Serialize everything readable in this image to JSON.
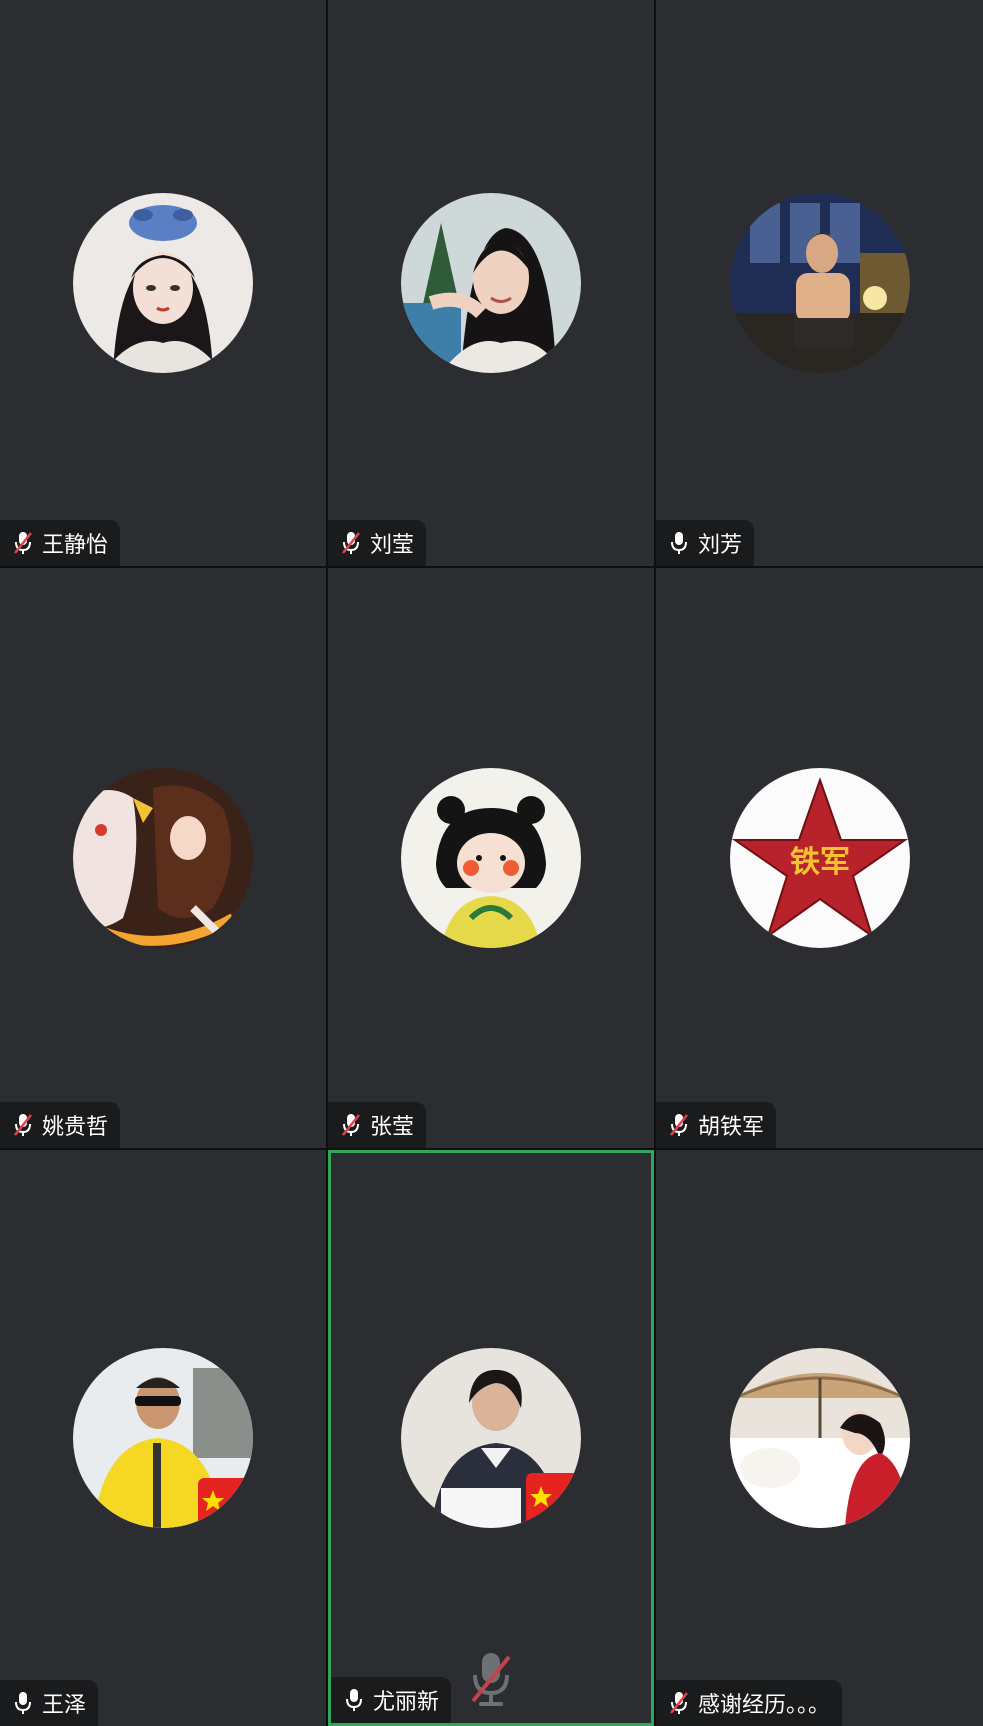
{
  "participants": [
    {
      "name": "王静怡",
      "mic": "muted",
      "avatar": "anime-girl"
    },
    {
      "name": "刘莹",
      "mic": "muted",
      "avatar": "woman-photo"
    },
    {
      "name": "刘芳",
      "mic": "on",
      "avatar": "woman-seated-photo"
    },
    {
      "name": "姚贵哲",
      "mic": "muted",
      "avatar": "anime-character"
    },
    {
      "name": "张莹",
      "mic": "muted",
      "avatar": "cartoon-girl"
    },
    {
      "name": "胡铁军",
      "mic": "muted",
      "avatar": "red-star",
      "avatar_text": "铁军"
    },
    {
      "name": "王泽",
      "mic": "on",
      "avatar": "man-yellow-jacket"
    },
    {
      "name": "尤丽新",
      "mic": "on",
      "avatar": "woman-writing",
      "active": true
    },
    {
      "name": "感谢经历。。。",
      "mic": "muted",
      "avatar": "umbrella-scene"
    }
  ],
  "colors": {
    "tile_bg": "#2b2d30",
    "gap": "#0d0e10",
    "active_border": "#2fa65a",
    "mute_red": "#e0434a",
    "label_bg": "#1a1b1d"
  }
}
